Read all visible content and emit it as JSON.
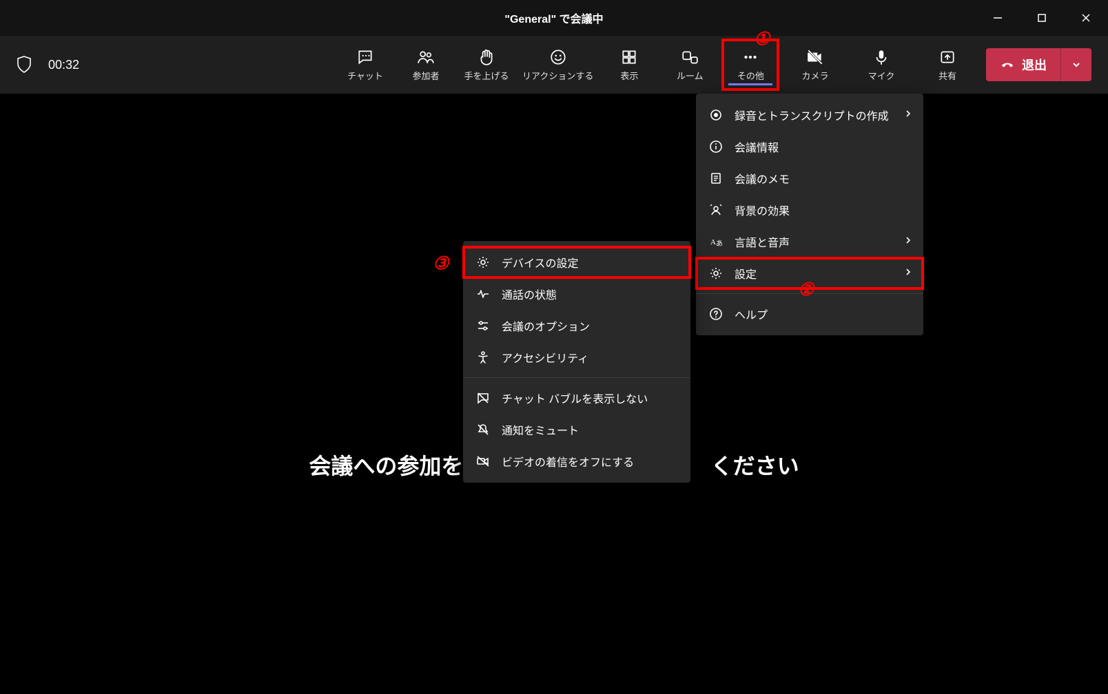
{
  "window": {
    "title": "\"General\" で会議中"
  },
  "toolbar": {
    "timer": "00:32",
    "chat": "チャット",
    "participants": "参加者",
    "raiseHand": "手を上げる",
    "reactions": "リアクションする",
    "view": "表示",
    "rooms": "ルーム",
    "more": "その他",
    "camera": "カメラ",
    "mic": "マイク",
    "share": "共有",
    "leave": "退出"
  },
  "overflowMenu": {
    "recording": "録音とトランスクリプトの作成",
    "meetingInfo": "会議情報",
    "meetingNotes": "会議のメモ",
    "backgroundEffects": "背景の効果",
    "languageSpeech": "言語と音声",
    "settings": "設定",
    "help": "ヘルプ"
  },
  "settingsSubmenu": {
    "deviceSettings": "デバイスの設定",
    "callHealth": "通話の状態",
    "meetingOptions": "会議のオプション",
    "accessibility": "アクセシビリティ",
    "noChatBubbles": "チャット バブルを表示しない",
    "muteNotifications": "通知をミュート",
    "turnOffVideo": "ビデオの着信をオフにする"
  },
  "main": {
    "bgLeft": "会議への参加を",
    "bgRight": "ください"
  },
  "annotations": {
    "a1": "①",
    "a2": "②",
    "a3": "③"
  }
}
